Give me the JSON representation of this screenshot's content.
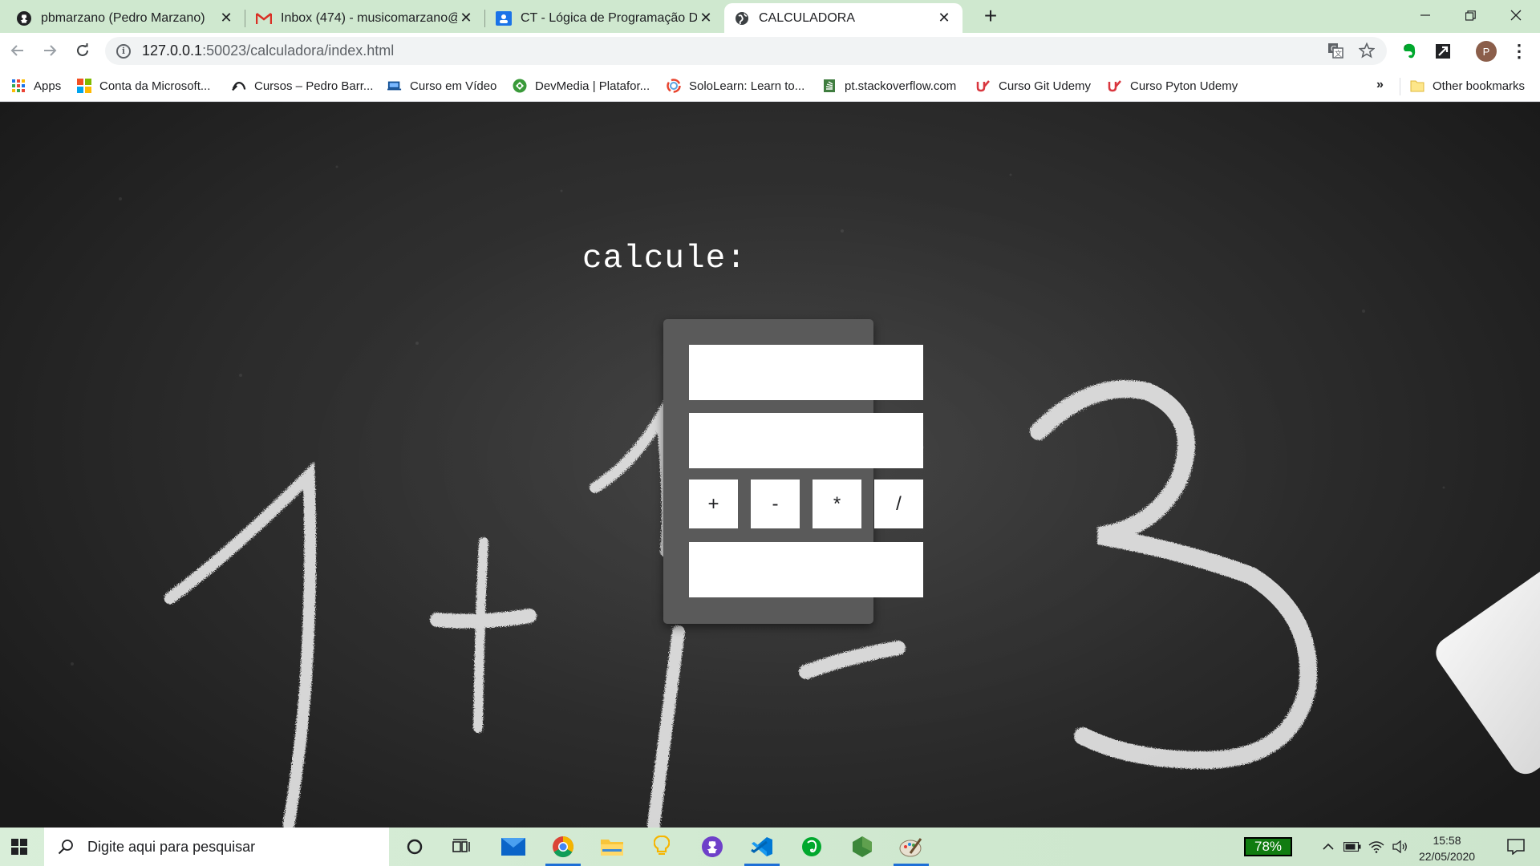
{
  "browser": {
    "tabs": [
      {
        "title": "pbmarzano (Pedro Marzano)",
        "icon": "github-icon",
        "active": false
      },
      {
        "title": "Inbox (474) - musicomarzano@g",
        "icon": "gmail-icon",
        "active": false
      },
      {
        "title": "CT - Lógica de Programação DES",
        "icon": "classroom-icon",
        "active": false
      },
      {
        "title": "CALCULADORA",
        "icon": "globe-icon",
        "active": true
      }
    ],
    "address": {
      "host": "127.0.0.1",
      "path": ":50023/calculadora/index.html"
    },
    "profile_initial": "P",
    "bookmarks": [
      {
        "label": "Apps",
        "icon": "apps-grid-icon"
      },
      {
        "label": "Conta da Microsoft...",
        "icon": "microsoft-icon"
      },
      {
        "label": "Cursos – Pedro Barr...",
        "icon": "cursos-icon"
      },
      {
        "label": "Curso em Vídeo",
        "icon": "cursoemvideo-icon"
      },
      {
        "label": "DevMedia | Platafor...",
        "icon": "devmedia-icon"
      },
      {
        "label": "SoloLearn: Learn to...",
        "icon": "sololearn-icon"
      },
      {
        "label": "pt.stackoverflow.com",
        "icon": "stackoverflow-icon"
      },
      {
        "label": "Curso Git Udemy",
        "icon": "udemy-icon"
      },
      {
        "label": "Curso Pyton Udemy",
        "icon": "udemy-icon"
      }
    ],
    "bookmarks_overflow": "»",
    "other_bookmarks": "Other bookmarks"
  },
  "page": {
    "heading": "calcule:",
    "input1_value": "",
    "input2_value": "",
    "result_value": "",
    "operators": [
      "+",
      "-",
      "*",
      "/"
    ]
  },
  "taskbar": {
    "search_placeholder": "Digite aqui para pesquisar",
    "battery": "78%",
    "time": "15:58",
    "date": "22/05/2020"
  },
  "colors": {
    "tab_strip": "#cfe8cf",
    "calc_panel": "#5a5a5a",
    "battery_badge": "#107c10"
  }
}
